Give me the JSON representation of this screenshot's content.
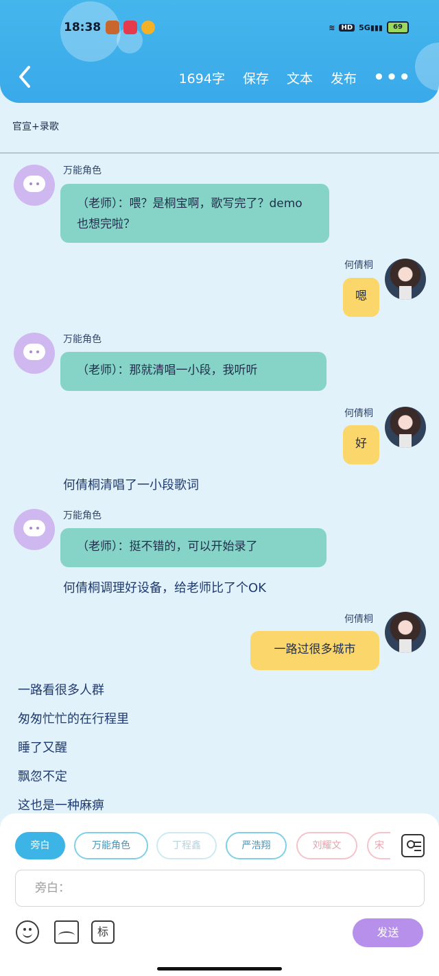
{
  "status_bar": {
    "time": "18:38",
    "battery": "69",
    "hd_label": "HD",
    "network_label": "5G"
  },
  "nav": {
    "word_count": "1694字",
    "save": "保存",
    "text": "文本",
    "publish": "发布",
    "more": "•••"
  },
  "topic": "官宣+录歌",
  "messages": [
    {
      "speaker": "万能角色",
      "text": "（老师）：喂？是桐宝啊，歌写完了？demo也想完啦？"
    },
    {
      "speaker": "何倩桐",
      "text": "嗯"
    },
    {
      "speaker": "万能角色",
      "text": "（老师）：那就清唱一小段，我听听"
    },
    {
      "speaker": "何倩桐",
      "text": "好"
    },
    {
      "narration": "何倩桐清唱了一小段歌词"
    },
    {
      "speaker": "万能角色",
      "text": "（老师）：挺不错的，可以开始录了"
    },
    {
      "narration": "何倩桐调理好设备，给老师比了个OK"
    },
    {
      "speaker": "何倩桐",
      "text": "一路过很多城市"
    }
  ],
  "lyrics": [
    "一路看很多人群",
    "匆匆忙忙的在行程里",
    "睡了又醒",
    "飘忽不定",
    "这也是一种麻痹"
  ],
  "composer": {
    "chips": [
      "旁白",
      "万能角色",
      "丁程鑫",
      "严浩翔",
      "刘耀文",
      "宋"
    ],
    "input_placeholder": "旁白：",
    "tag_label": "标",
    "send_label": "发送"
  }
}
